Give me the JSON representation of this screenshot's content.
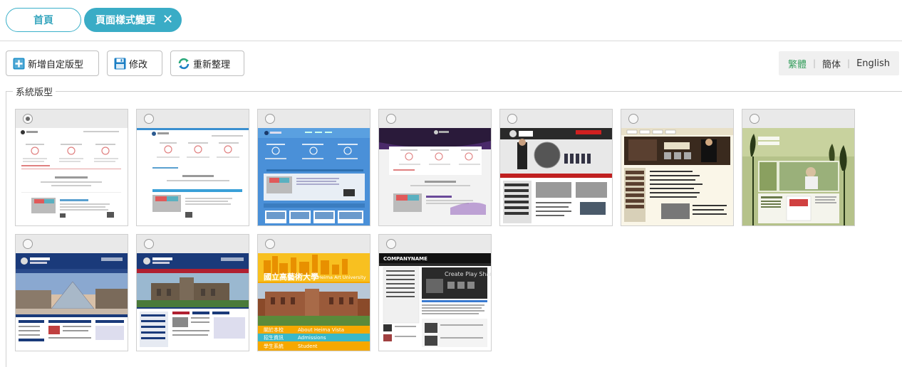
{
  "tabs": {
    "home": "首頁",
    "active": "頁面樣式變更",
    "close_icon": "close-icon"
  },
  "toolbar": {
    "add_label": "新增自定版型",
    "edit_label": "修改",
    "refresh_label": "重新整理"
  },
  "languages": [
    {
      "label": "繁體",
      "active": true
    },
    {
      "label": "簡体",
      "active": false
    },
    {
      "label": "English",
      "active": false
    }
  ],
  "group_title": "系統版型",
  "templates": [
    {
      "selected": true,
      "style": "light-responsive"
    },
    {
      "selected": false,
      "style": "light-responsive-2"
    },
    {
      "selected": false,
      "style": "blue-responsive"
    },
    {
      "selected": false,
      "style": "dark-purple-responsive"
    },
    {
      "selected": false,
      "style": "university-globe"
    },
    {
      "selected": false,
      "style": "university-brown"
    },
    {
      "selected": false,
      "style": "design-studio-green"
    },
    {
      "selected": false,
      "style": "blue-louvre"
    },
    {
      "selected": false,
      "style": "blue-red-campus"
    },
    {
      "selected": false,
      "style": "orange-art-university",
      "texts": [
        "國立高藝術大學",
        "Heima Art University",
        "關於本校",
        "About Heima Vista",
        "招生資訊",
        "Admissions",
        "學生系統",
        "Student"
      ]
    },
    {
      "selected": false,
      "style": "dark-companyname",
      "texts": [
        "COMPANYNAME",
        "Create Play Share"
      ]
    }
  ],
  "colors": {
    "accent": "#3aacc6",
    "lang_active": "#3aa060"
  }
}
